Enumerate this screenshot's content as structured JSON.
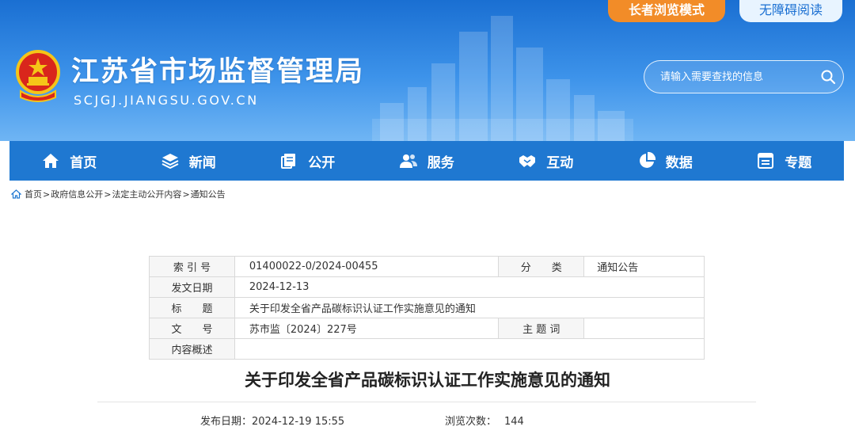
{
  "header": {
    "site_title": "江苏省市场监督管理局",
    "site_domain": "SCJGJ.JIANGSU.GOV.CN",
    "elder_mode_label": "长者浏览模式",
    "accessibility_label": "无障碍阅读",
    "search_placeholder": "请输入需要查找的信息"
  },
  "nav": {
    "items": [
      {
        "label": "首页",
        "icon": "home-icon"
      },
      {
        "label": "新闻",
        "icon": "layers-icon"
      },
      {
        "label": "公开",
        "icon": "document-stack-icon"
      },
      {
        "label": "服务",
        "icon": "users-icon"
      },
      {
        "label": "互动",
        "icon": "handshake-icon"
      },
      {
        "label": "数据",
        "icon": "pie-chart-icon"
      },
      {
        "label": "专题",
        "icon": "window-icon"
      }
    ]
  },
  "breadcrumb": {
    "items": [
      "首页",
      "政府信息公开",
      "法定主动公开内容",
      "通知公告"
    ],
    "separator": ">"
  },
  "info": {
    "index_label": "索 引 号",
    "index_value": "01400022-0/2024-00455",
    "category_label": "分　　类",
    "category_value": "通知公告",
    "date_label": "发文日期",
    "date_value": "2024-12-13",
    "title_label": "标　　题",
    "title_value": "关于印发全省产品碳标识认证工作实施意见的通知",
    "doc_no_label": "文　　号",
    "doc_no_value": "苏市监〔2024〕227号",
    "subject_label": "主 题 词",
    "subject_value": "",
    "summary_label": "内容概述",
    "summary_value": ""
  },
  "article": {
    "title": "关于印发全省产品碳标识认证工作实施意见的通知",
    "publish_label": "发布日期：",
    "publish_value": "2024-12-19 15:55",
    "views_label": "浏览次数：",
    "views_value": "144"
  },
  "colors": {
    "header_blue": "#1a6fd2",
    "nav_blue": "#1f78d1",
    "elder_orange": "#f28c28"
  }
}
